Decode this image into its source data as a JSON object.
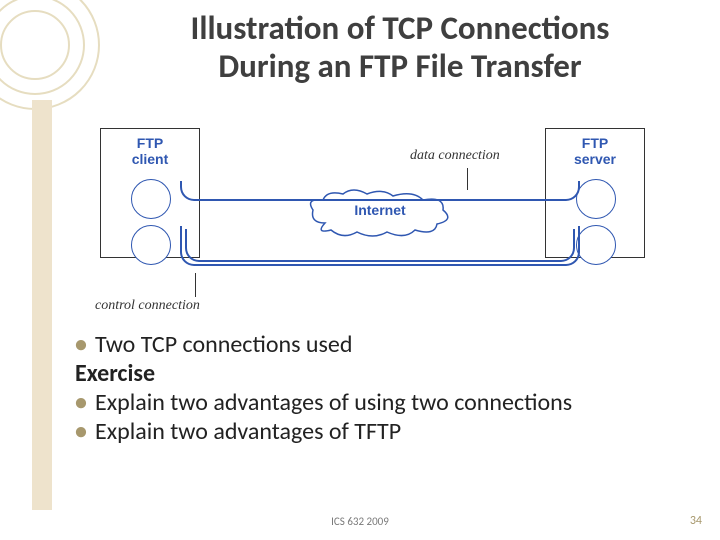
{
  "title_line1": "Illustration of TCP Connections",
  "title_line2": "During an FTP File Transfer",
  "diagram": {
    "client_label": "FTP\nclient",
    "server_label": "FTP\nserver",
    "internet_label": "Internet",
    "data_conn_label": "data connection",
    "control_conn_label": "control connection"
  },
  "bullets": {
    "b1": "Two TCP connections used",
    "exercise_label": "Exercise",
    "b2": "Explain two advantages of using two connections",
    "b3": "Explain two advantages of TFTP"
  },
  "footer_text": "ICS 632 2009",
  "page_number": "34"
}
